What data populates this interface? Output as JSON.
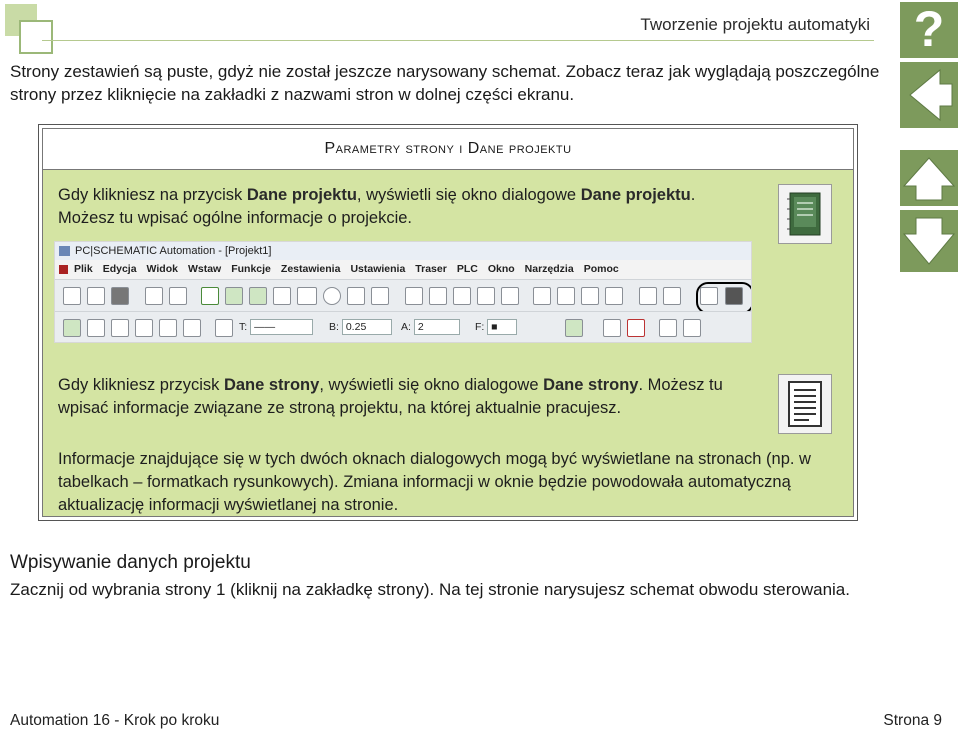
{
  "header": {
    "title": "Tworzenie projektu automatyki"
  },
  "nav": {
    "help_label": "?"
  },
  "intro_text": "Strony zestawień są puste, gdyż nie został jeszcze narysowany schemat. Zobacz teraz jak wyglądają poszczególne strony przez kliknięcie na zakładki z nazwami stron w dolnej części ekranu.",
  "box": {
    "title": "Parametry strony i Dane projektu",
    "p1": {
      "pre": "Gdy klikniesz na przycisk ",
      "bold1": "Dane projektu",
      "mid": ", wyświetli się okno dialogowe ",
      "bold2": "Dane projektu",
      "post": ". Możesz tu wpisać ogólne informacje o projekcie."
    },
    "p2": {
      "pre": "Gdy klikniesz przycisk ",
      "bold1": "Dane strony",
      "mid": ", wyświetli się okno dialogowe ",
      "bold2": "Dane strony",
      "post": ". Możesz tu wpisać informacje związane ze stroną projektu, na której aktualnie pracujesz."
    },
    "p3": "Informacje znajdujące się w tych dwóch oknach dialogowych mogą być wyświetlane na stronach (np. w tabelkach – formatkach rysunkowych). Zmiana informacji w oknie będzie powodowała automatyczną aktualizację informacji wyświetlanej na stronie."
  },
  "screenshot": {
    "window_title": "PC|SCHEMATIC Automation - [Projekt1]",
    "menu": [
      "Plik",
      "Edycja",
      "Widok",
      "Wstaw",
      "Funkcje",
      "Zestawienia",
      "Ustawienia",
      "Traser",
      "PLC",
      "Okno",
      "Narzędzia",
      "Pomoc"
    ],
    "fields": {
      "t_label": "T:",
      "b_label": "B:",
      "b_value": "0.25",
      "a_label": "A:",
      "a_value": "2",
      "f_label": "F:"
    }
  },
  "section": {
    "heading": "Wpisywanie danych projektu",
    "body": "Zacznij od wybrania strony 1 (kliknij na zakładkę strony). Na tej stronie narysujesz schemat obwodu sterowania."
  },
  "footer": {
    "left": "Automation 16 - Krok po kroku",
    "right": "Strona 9"
  },
  "colors": {
    "accent_green": "#7d9a5c",
    "box_background": "#d4e4a3"
  }
}
